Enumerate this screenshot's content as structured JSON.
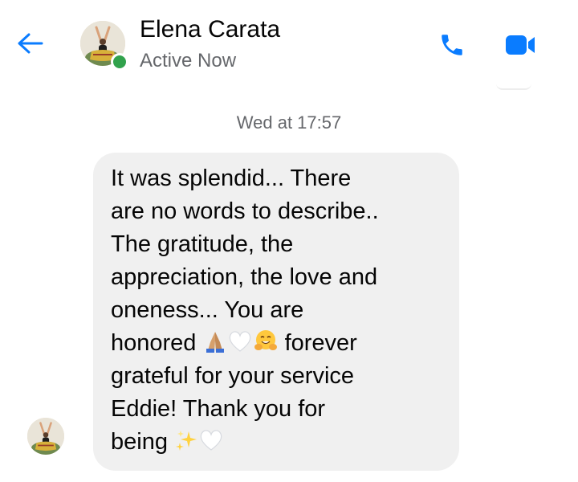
{
  "header": {
    "contact_name": "Elena Carata",
    "status": "Active Now",
    "presence": "online",
    "icons": {
      "back": "arrow-left-icon",
      "call": "phone-icon",
      "video": "video-camera-icon"
    }
  },
  "conversation": {
    "timestamp": "Wed at 17:57",
    "messages": [
      {
        "sender": "Elena Carata",
        "direction": "incoming",
        "lines": [
          {
            "text": "It was splendid... There"
          },
          {
            "text": "are no words to describe.."
          },
          {
            "text": "The gratitude, the"
          },
          {
            "text": "appreciation, the love and"
          },
          {
            "text": "oneness... You are"
          },
          {
            "text": "honored",
            "emoji": [
              "folded-hands",
              "white-heart",
              "hugging-face"
            ],
            "text_after": "forever"
          },
          {
            "text": "grateful for your service"
          },
          {
            "text": "Eddie! Thank you for"
          },
          {
            "text": "being",
            "emoji": [
              "sparkles",
              "white-heart"
            ]
          }
        ]
      }
    ]
  },
  "colors": {
    "accent": "#0a7cff",
    "presence_green": "#31a24c",
    "bubble_bg": "#f0f0f0",
    "text_primary": "#050505",
    "text_secondary": "#65676b"
  }
}
